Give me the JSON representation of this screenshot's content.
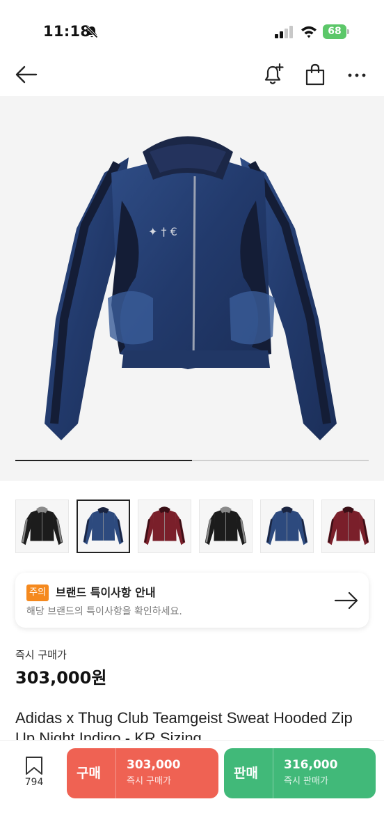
{
  "status_bar": {
    "time": "11:18",
    "battery": "68",
    "mute_icon": "bell-slash-icon",
    "signal_icon": "cellular-signal-icon",
    "wifi_icon": "wifi-icon",
    "battery_icon": "battery-charging-icon"
  },
  "nav": {
    "back_icon": "arrow-left-icon",
    "alert_icon": "bell-plus-icon",
    "bag_icon": "shopping-bag-icon",
    "more_icon": "more-horizontal-icon"
  },
  "gallery": {
    "progress": 0.5,
    "selected_index": 1,
    "thumbnails": [
      {
        "color": "#1c1c1c",
        "stripe": "#8a8a8a"
      },
      {
        "color": "#2d4a7e",
        "stripe": "#1a2440"
      },
      {
        "color": "#7a1f2a",
        "stripe": "#3a0f16"
      },
      {
        "color": "#1c1c1c",
        "stripe": "#8a8a8a"
      },
      {
        "color": "#2d4a7e",
        "stripe": "#1a2440"
      },
      {
        "color": "#7a1f2a",
        "stripe": "#3a0f16"
      }
    ]
  },
  "notice": {
    "badge": "주의",
    "title": "브랜드 특이사항 안내",
    "subtitle": "해당 브랜드의 특이사항을 확인하세요.",
    "arrow_icon": "arrow-right-icon"
  },
  "price": {
    "label": "즉시 구매가",
    "value": "303,000원"
  },
  "product": {
    "title": "Adidas x Thug Club Teamgeist Sweat Hooded Zip Up Night Indigo - KR Sizing"
  },
  "bottom_bar": {
    "bookmark_icon": "bookmark-icon",
    "bookmark_count": "794",
    "buy": {
      "label": "구매",
      "price": "303,000",
      "sub": "즉시 구매가",
      "color": "#ef6253"
    },
    "sell": {
      "label": "판매",
      "price": "316,000",
      "sub": "즉시 판매가",
      "color": "#41b979"
    }
  }
}
